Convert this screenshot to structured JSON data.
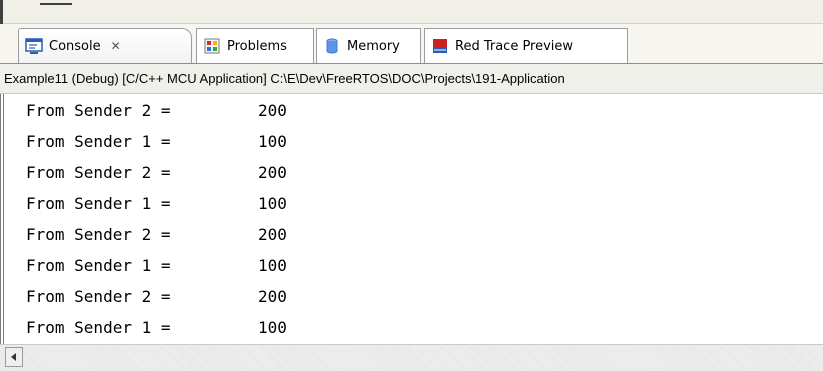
{
  "tabs": [
    {
      "label": "Console",
      "icon": "console-icon",
      "active": true,
      "closable": true
    },
    {
      "label": "Problems",
      "icon": "problems-icon"
    },
    {
      "label": "Memory",
      "icon": "memory-icon"
    },
    {
      "label": "Red Trace Preview",
      "icon": "red-trace-icon"
    }
  ],
  "console": {
    "path": "Example11 (Debug) [C/C++ MCU Application] C:\\E\\Dev\\FreeRTOS\\DOC\\Projects\\191-Application",
    "lines": [
      {
        "label": "From Sender 2 =",
        "value": "200"
      },
      {
        "label": "From Sender 1 =",
        "value": "100"
      },
      {
        "label": "From Sender 2 =",
        "value": "200"
      },
      {
        "label": "From Sender 1 =",
        "value": "100"
      },
      {
        "label": "From Sender 2 =",
        "value": "200"
      },
      {
        "label": "From Sender 1 =",
        "value": "100"
      },
      {
        "label": "From Sender 2 =",
        "value": "200"
      },
      {
        "label": "From Sender 1 =",
        "value": "100"
      }
    ]
  },
  "colors": {
    "console_icon": "#2a5db0",
    "memory_icon": "#3b78d8",
    "trace_icon_red": "#cc1f1f"
  }
}
